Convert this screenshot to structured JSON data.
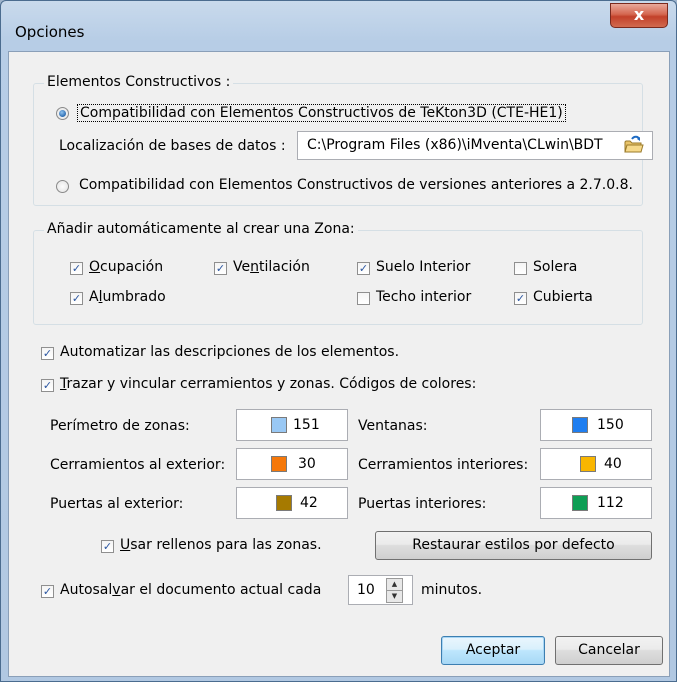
{
  "window": {
    "title": "Opciones",
    "close_glyph": "x"
  },
  "constructive": {
    "legend": "Elementos Constructivos :",
    "option1": "Compatibilidad con Elementos Constructivos de TeKton3D (CTE-HE1)",
    "db_label": "Localización de bases de datos :",
    "db_path": "C:\\Program Files (x86)\\iMventa\\CLwin\\BDT",
    "option2": "Compatibilidad con Elementos Constructivos de versiones anteriores a 2.7.0.8.",
    "selected": "option1"
  },
  "zone": {
    "legend": "Añadir automáticamente al crear una Zona:",
    "items": [
      {
        "label": "Ocupación",
        "checked": true
      },
      {
        "label": "Ventilación",
        "checked": true
      },
      {
        "label": "Suelo Interior",
        "checked": true
      },
      {
        "label": "Solera",
        "checked": false
      },
      {
        "label": "Alumbrado",
        "checked": true
      },
      {
        "label": "Techo interior",
        "checked": false
      },
      {
        "label": "Cubierta",
        "checked": true
      }
    ]
  },
  "auto_desc": {
    "label": "Automatizar las descripciones de los elementos.",
    "checked": true
  },
  "trazar": {
    "label": "Trazar y vincular cerramientos y zonas. Códigos de colores:",
    "checked": true
  },
  "colors": [
    {
      "label": "Perímetro de zonas:",
      "value": "151",
      "color": "#99c8f4"
    },
    {
      "label": "Ventanas:",
      "value": "150",
      "color": "#1f7ef0"
    },
    {
      "label": "Cerramientos al exterior:",
      "value": "30",
      "color": "#f5780a"
    },
    {
      "label": "Cerramientos interiores:",
      "value": "40",
      "color": "#f9b600"
    },
    {
      "label": "Puertas al exterior:",
      "value": "42",
      "color": "#a67a00"
    },
    {
      "label": "Puertas interiores:",
      "value": "112",
      "color": "#0e9e55"
    }
  ],
  "fill": {
    "label": "Usar rellenos para las zonas.",
    "checked": true
  },
  "restore_button": "Restaurar estilos por defecto",
  "autosave": {
    "label": "Autosalvar el documento actual cada",
    "value": "10",
    "suffix": "minutos.",
    "checked": true
  },
  "buttons": {
    "accept": "Aceptar",
    "cancel": "Cancelar"
  }
}
